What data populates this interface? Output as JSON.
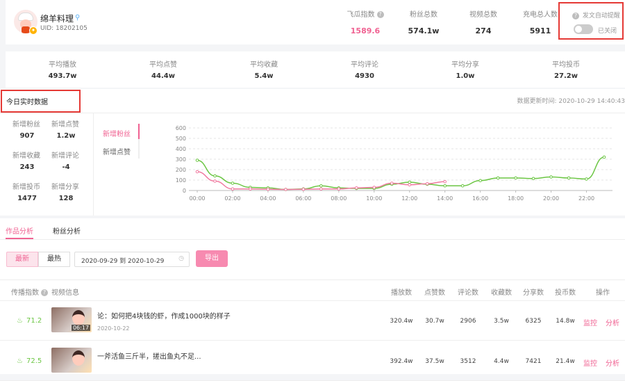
{
  "profile": {
    "name": "绵羊料理",
    "uid": "UID: 18202105"
  },
  "stats": [
    {
      "label": "飞瓜指数",
      "value": "1589.6",
      "help": true,
      "pink": true
    },
    {
      "label": "粉丝总数",
      "value": "574.1w"
    },
    {
      "label": "视频总数",
      "value": "274"
    },
    {
      "label": "充电总人数",
      "value": "5911"
    }
  ],
  "notify": {
    "label": "发文自动提醒",
    "toggle_text": "已关闭"
  },
  "averages": [
    {
      "label": "平均播放",
      "value": "493.7w"
    },
    {
      "label": "平均点赞",
      "value": "44.4w"
    },
    {
      "label": "平均收藏",
      "value": "5.4w"
    },
    {
      "label": "平均评论",
      "value": "4930"
    },
    {
      "label": "平均分享",
      "value": "1.0w"
    },
    {
      "label": "平均投币",
      "value": "27.2w"
    }
  ],
  "today": {
    "title": "今日实时数据",
    "updated": "数据更新时间: 2020-10-29 14:40:43",
    "metrics": [
      {
        "label": "新增粉丝",
        "value": "907"
      },
      {
        "label": "新增点赞",
        "value": "1.2w"
      },
      {
        "label": "新增收藏",
        "value": "243"
      },
      {
        "label": "新增评论",
        "value": "-4"
      },
      {
        "label": "新增投币",
        "value": "1477"
      },
      {
        "label": "新增分享",
        "value": "128"
      }
    ],
    "chart_tabs": [
      "新增粉丝",
      "新增点赞"
    ]
  },
  "chart_data": {
    "type": "line",
    "x": [
      "00:00",
      "01:00",
      "02:00",
      "03:00",
      "04:00",
      "05:00",
      "06:00",
      "07:00",
      "08:00",
      "09:00",
      "10:00",
      "11:00",
      "12:00",
      "13:00",
      "14:00",
      "15:00",
      "16:00",
      "17:00",
      "18:00",
      "19:00",
      "20:00",
      "21:00",
      "22:00",
      "23:00"
    ],
    "x_ticks": [
      "00:00",
      "02:00",
      "04:00",
      "06:00",
      "08:00",
      "10:00",
      "12:00",
      "14:00",
      "16:00",
      "18:00",
      "20:00",
      "22:00"
    ],
    "y_ticks": [
      "0",
      "100",
      "200",
      "300",
      "400",
      "500",
      "600"
    ],
    "ylim": [
      0,
      600
    ],
    "series": [
      {
        "color": "#6cc644",
        "values": [
          290,
          140,
          70,
          30,
          25,
          10,
          15,
          45,
          25,
          20,
          20,
          60,
          80,
          60,
          45,
          45,
          95,
          120,
          120,
          115,
          130,
          120,
          110,
          320
        ]
      },
      {
        "color": "#f07aa0",
        "values": [
          180,
          90,
          15,
          15,
          12,
          10,
          12,
          15,
          15,
          25,
          30,
          70,
          55,
          65,
          85
        ]
      }
    ],
    "grid": true
  },
  "analysis_tabs": [
    "作品分析",
    "粉丝分析"
  ],
  "filter": {
    "latest": "最新",
    "hottest": "最热",
    "date_range": "2020-09-29 到 2020-10-29",
    "export": "导出"
  },
  "table": {
    "headers": [
      "传播指数",
      "视频信息",
      "播放数",
      "点赞数",
      "评论数",
      "收藏数",
      "分享数",
      "投币数",
      "操作"
    ],
    "rows": [
      {
        "score": "71.2",
        "title": "论：如何把4块钱的虾，作成1000块的样子",
        "date": "2020-10-22",
        "duration": "06:17",
        "plays": "320.4w",
        "likes": "30.7w",
        "comments": "2906",
        "favs": "3.5w",
        "shares": "6325",
        "coins": "14.8w",
        "monitor": "监控",
        "analyze": "分析"
      },
      {
        "score": "72.5",
        "title": "一斧活鱼三斤半，搓出鱼丸不足...",
        "date": "",
        "duration": "",
        "plays": "392.4w",
        "likes": "37.5w",
        "comments": "3512",
        "favs": "4.4w",
        "shares": "7421",
        "coins": "21.4w",
        "monitor": "监控",
        "analyze": "分析"
      }
    ]
  }
}
